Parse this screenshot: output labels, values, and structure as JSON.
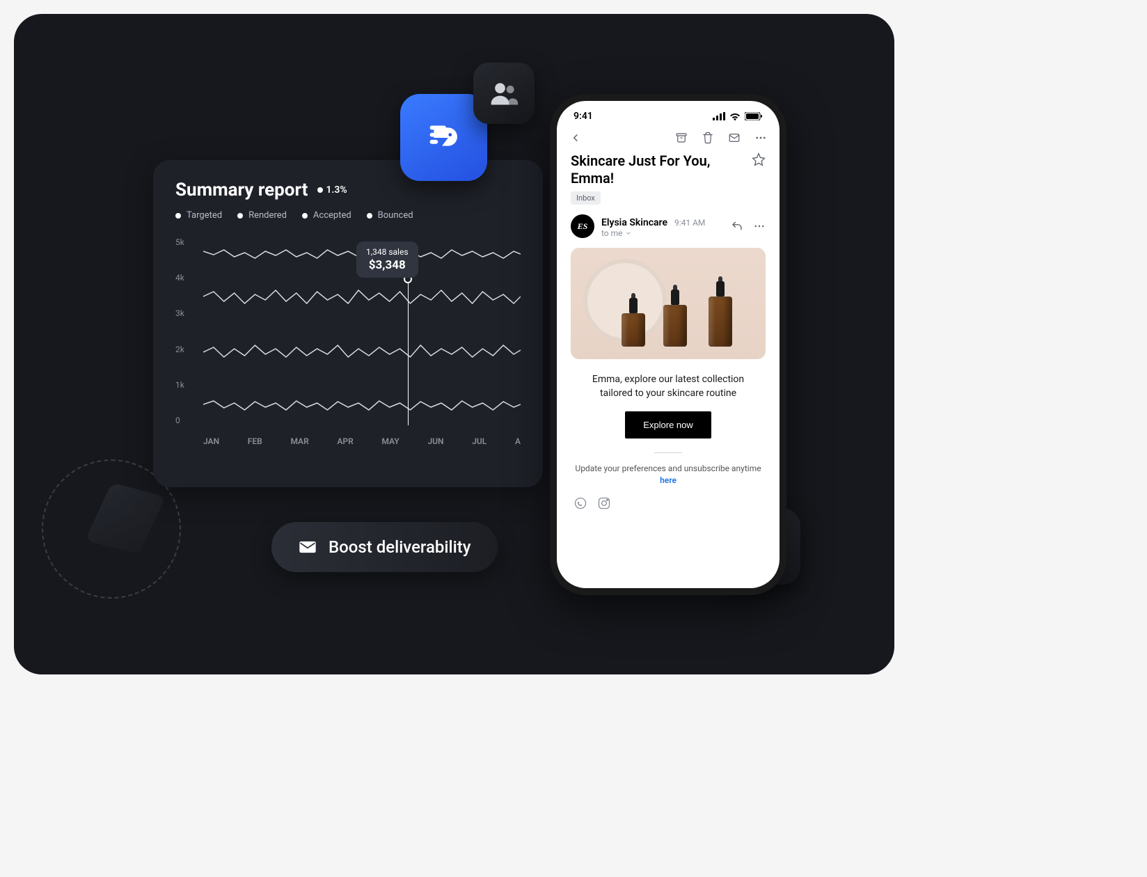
{
  "report": {
    "title": "Summary report",
    "delta": "1.3%",
    "legend": [
      "Targeted",
      "Rendered",
      "Accepted",
      "Bounced"
    ],
    "y_ticks": [
      "5k",
      "4k",
      "3k",
      "2k",
      "1k",
      "0"
    ],
    "x_ticks": [
      "JAN",
      "FEB",
      "MAR",
      "APR",
      "MAY",
      "JUN",
      "JUL",
      "A"
    ],
    "tooltip": {
      "label": "1,348 sales",
      "value": "$3,348"
    }
  },
  "boost": {
    "label": "Boost deliverability"
  },
  "phone": {
    "time": "9:41",
    "subject": "Skincare Just For You, Emma!",
    "inbox_badge": "Inbox",
    "sender": {
      "name": "Elysia Skincare",
      "initials": "ES",
      "time": "9:41 AM",
      "to": "to me"
    },
    "body_text": "Emma, explore our latest collection tailored to your skincare routine",
    "cta": "Explore now",
    "footer_prefix": "Update your preferences and unsubscribe anytime ",
    "footer_link": "here"
  },
  "chart_data": {
    "type": "line",
    "title": "Summary report",
    "xlabel": "",
    "ylabel": "",
    "ylim": [
      0,
      5000
    ],
    "x_ticks": [
      "JAN",
      "FEB",
      "MAR",
      "APR",
      "MAY",
      "JUN",
      "JUL",
      "A"
    ],
    "y_ticks": [
      0,
      1000,
      2000,
      3000,
      4000,
      5000
    ],
    "series": [
      {
        "name": "Targeted",
        "approx_mean": 4700
      },
      {
        "name": "Rendered",
        "approx_mean": 3500
      },
      {
        "name": "Accepted",
        "approx_mean": 2000
      },
      {
        "name": "Bounced",
        "approx_mean": 600
      }
    ],
    "highlight": {
      "x_approx": "MAY",
      "sales_count": 1348,
      "sales_value_usd": 3348
    }
  }
}
